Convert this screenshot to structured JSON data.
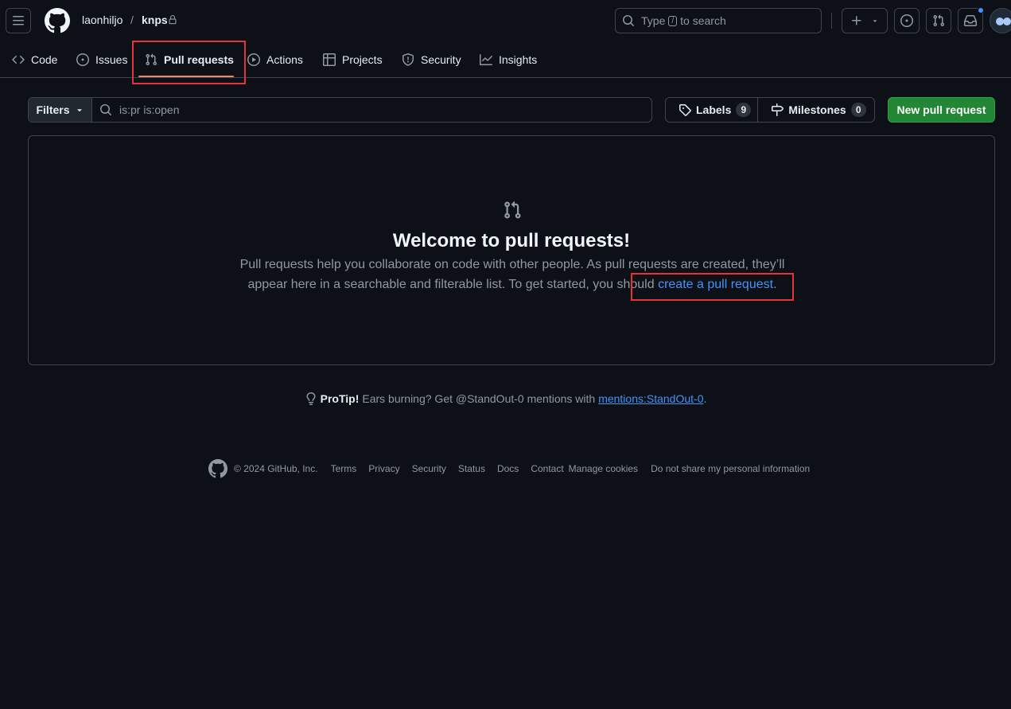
{
  "header": {
    "owner": "laonhiljo",
    "separator": "/",
    "repo": "knps",
    "search_prefix": "Type",
    "search_key": "/",
    "search_suffix": "to search"
  },
  "tabs": [
    {
      "label": "Code",
      "icon": "code-icon"
    },
    {
      "label": "Issues",
      "icon": "issue-opened-icon"
    },
    {
      "label": "Pull requests",
      "icon": "git-pull-request-icon",
      "active": true
    },
    {
      "label": "Actions",
      "icon": "play-icon"
    },
    {
      "label": "Projects",
      "icon": "table-icon"
    },
    {
      "label": "Security",
      "icon": "shield-icon"
    },
    {
      "label": "Insights",
      "icon": "graph-icon"
    }
  ],
  "toolbar": {
    "filters_label": "Filters",
    "search_value": "is:pr is:open",
    "labels_label": "Labels",
    "labels_count": "9",
    "milestones_label": "Milestones",
    "milestones_count": "0",
    "new_pr_label": "New pull request"
  },
  "blankslate": {
    "title": "Welcome to pull requests!",
    "text_1": "Pull requests help you collaborate on code with other people. As pull requests are created, they’ll appear here in a searchable and filterable list. To get started, you should ",
    "link": "create a pull request",
    "text_end": "."
  },
  "protip": {
    "label": "ProTip!",
    "text": "Ears burning? Get @StandOut-0 mentions with",
    "link": "mentions:StandOut-0",
    "end": "."
  },
  "footer": {
    "copyright": "© 2024 GitHub, Inc.",
    "links": [
      "Terms",
      "Privacy",
      "Security",
      "Status",
      "Docs",
      "Contact",
      "Manage cookies",
      "Do not share my personal information"
    ]
  },
  "colors": {
    "background": "#0d1117",
    "border": "#3d444d",
    "accent_link": "#4493f8",
    "active_underline": "#f78166",
    "primary_button": "#238636",
    "highlight_box": "#e5333a"
  }
}
